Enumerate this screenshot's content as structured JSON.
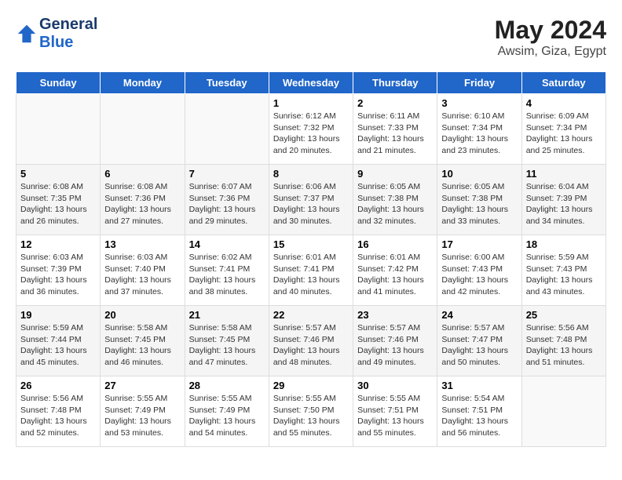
{
  "header": {
    "logo_line1": "General",
    "logo_line2": "Blue",
    "main_title": "May 2024",
    "sub_title": "Awsim, Giza, Egypt"
  },
  "weekdays": [
    "Sunday",
    "Monday",
    "Tuesday",
    "Wednesday",
    "Thursday",
    "Friday",
    "Saturday"
  ],
  "weeks": [
    [
      {
        "day": "",
        "sunrise": "",
        "sunset": "",
        "daylight": ""
      },
      {
        "day": "",
        "sunrise": "",
        "sunset": "",
        "daylight": ""
      },
      {
        "day": "",
        "sunrise": "",
        "sunset": "",
        "daylight": ""
      },
      {
        "day": "1",
        "sunrise": "Sunrise: 6:12 AM",
        "sunset": "Sunset: 7:32 PM",
        "daylight": "Daylight: 13 hours and 20 minutes."
      },
      {
        "day": "2",
        "sunrise": "Sunrise: 6:11 AM",
        "sunset": "Sunset: 7:33 PM",
        "daylight": "Daylight: 13 hours and 21 minutes."
      },
      {
        "day": "3",
        "sunrise": "Sunrise: 6:10 AM",
        "sunset": "Sunset: 7:34 PM",
        "daylight": "Daylight: 13 hours and 23 minutes."
      },
      {
        "day": "4",
        "sunrise": "Sunrise: 6:09 AM",
        "sunset": "Sunset: 7:34 PM",
        "daylight": "Daylight: 13 hours and 25 minutes."
      }
    ],
    [
      {
        "day": "5",
        "sunrise": "Sunrise: 6:08 AM",
        "sunset": "Sunset: 7:35 PM",
        "daylight": "Daylight: 13 hours and 26 minutes."
      },
      {
        "day": "6",
        "sunrise": "Sunrise: 6:08 AM",
        "sunset": "Sunset: 7:36 PM",
        "daylight": "Daylight: 13 hours and 27 minutes."
      },
      {
        "day": "7",
        "sunrise": "Sunrise: 6:07 AM",
        "sunset": "Sunset: 7:36 PM",
        "daylight": "Daylight: 13 hours and 29 minutes."
      },
      {
        "day": "8",
        "sunrise": "Sunrise: 6:06 AM",
        "sunset": "Sunset: 7:37 PM",
        "daylight": "Daylight: 13 hours and 30 minutes."
      },
      {
        "day": "9",
        "sunrise": "Sunrise: 6:05 AM",
        "sunset": "Sunset: 7:38 PM",
        "daylight": "Daylight: 13 hours and 32 minutes."
      },
      {
        "day": "10",
        "sunrise": "Sunrise: 6:05 AM",
        "sunset": "Sunset: 7:38 PM",
        "daylight": "Daylight: 13 hours and 33 minutes."
      },
      {
        "day": "11",
        "sunrise": "Sunrise: 6:04 AM",
        "sunset": "Sunset: 7:39 PM",
        "daylight": "Daylight: 13 hours and 34 minutes."
      }
    ],
    [
      {
        "day": "12",
        "sunrise": "Sunrise: 6:03 AM",
        "sunset": "Sunset: 7:39 PM",
        "daylight": "Daylight: 13 hours and 36 minutes."
      },
      {
        "day": "13",
        "sunrise": "Sunrise: 6:03 AM",
        "sunset": "Sunset: 7:40 PM",
        "daylight": "Daylight: 13 hours and 37 minutes."
      },
      {
        "day": "14",
        "sunrise": "Sunrise: 6:02 AM",
        "sunset": "Sunset: 7:41 PM",
        "daylight": "Daylight: 13 hours and 38 minutes."
      },
      {
        "day": "15",
        "sunrise": "Sunrise: 6:01 AM",
        "sunset": "Sunset: 7:41 PM",
        "daylight": "Daylight: 13 hours and 40 minutes."
      },
      {
        "day": "16",
        "sunrise": "Sunrise: 6:01 AM",
        "sunset": "Sunset: 7:42 PM",
        "daylight": "Daylight: 13 hours and 41 minutes."
      },
      {
        "day": "17",
        "sunrise": "Sunrise: 6:00 AM",
        "sunset": "Sunset: 7:43 PM",
        "daylight": "Daylight: 13 hours and 42 minutes."
      },
      {
        "day": "18",
        "sunrise": "Sunrise: 5:59 AM",
        "sunset": "Sunset: 7:43 PM",
        "daylight": "Daylight: 13 hours and 43 minutes."
      }
    ],
    [
      {
        "day": "19",
        "sunrise": "Sunrise: 5:59 AM",
        "sunset": "Sunset: 7:44 PM",
        "daylight": "Daylight: 13 hours and 45 minutes."
      },
      {
        "day": "20",
        "sunrise": "Sunrise: 5:58 AM",
        "sunset": "Sunset: 7:45 PM",
        "daylight": "Daylight: 13 hours and 46 minutes."
      },
      {
        "day": "21",
        "sunrise": "Sunrise: 5:58 AM",
        "sunset": "Sunset: 7:45 PM",
        "daylight": "Daylight: 13 hours and 47 minutes."
      },
      {
        "day": "22",
        "sunrise": "Sunrise: 5:57 AM",
        "sunset": "Sunset: 7:46 PM",
        "daylight": "Daylight: 13 hours and 48 minutes."
      },
      {
        "day": "23",
        "sunrise": "Sunrise: 5:57 AM",
        "sunset": "Sunset: 7:46 PM",
        "daylight": "Daylight: 13 hours and 49 minutes."
      },
      {
        "day": "24",
        "sunrise": "Sunrise: 5:57 AM",
        "sunset": "Sunset: 7:47 PM",
        "daylight": "Daylight: 13 hours and 50 minutes."
      },
      {
        "day": "25",
        "sunrise": "Sunrise: 5:56 AM",
        "sunset": "Sunset: 7:48 PM",
        "daylight": "Daylight: 13 hours and 51 minutes."
      }
    ],
    [
      {
        "day": "26",
        "sunrise": "Sunrise: 5:56 AM",
        "sunset": "Sunset: 7:48 PM",
        "daylight": "Daylight: 13 hours and 52 minutes."
      },
      {
        "day": "27",
        "sunrise": "Sunrise: 5:55 AM",
        "sunset": "Sunset: 7:49 PM",
        "daylight": "Daylight: 13 hours and 53 minutes."
      },
      {
        "day": "28",
        "sunrise": "Sunrise: 5:55 AM",
        "sunset": "Sunset: 7:49 PM",
        "daylight": "Daylight: 13 hours and 54 minutes."
      },
      {
        "day": "29",
        "sunrise": "Sunrise: 5:55 AM",
        "sunset": "Sunset: 7:50 PM",
        "daylight": "Daylight: 13 hours and 55 minutes."
      },
      {
        "day": "30",
        "sunrise": "Sunrise: 5:55 AM",
        "sunset": "Sunset: 7:51 PM",
        "daylight": "Daylight: 13 hours and 55 minutes."
      },
      {
        "day": "31",
        "sunrise": "Sunrise: 5:54 AM",
        "sunset": "Sunset: 7:51 PM",
        "daylight": "Daylight: 13 hours and 56 minutes."
      },
      {
        "day": "",
        "sunrise": "",
        "sunset": "",
        "daylight": ""
      }
    ]
  ]
}
